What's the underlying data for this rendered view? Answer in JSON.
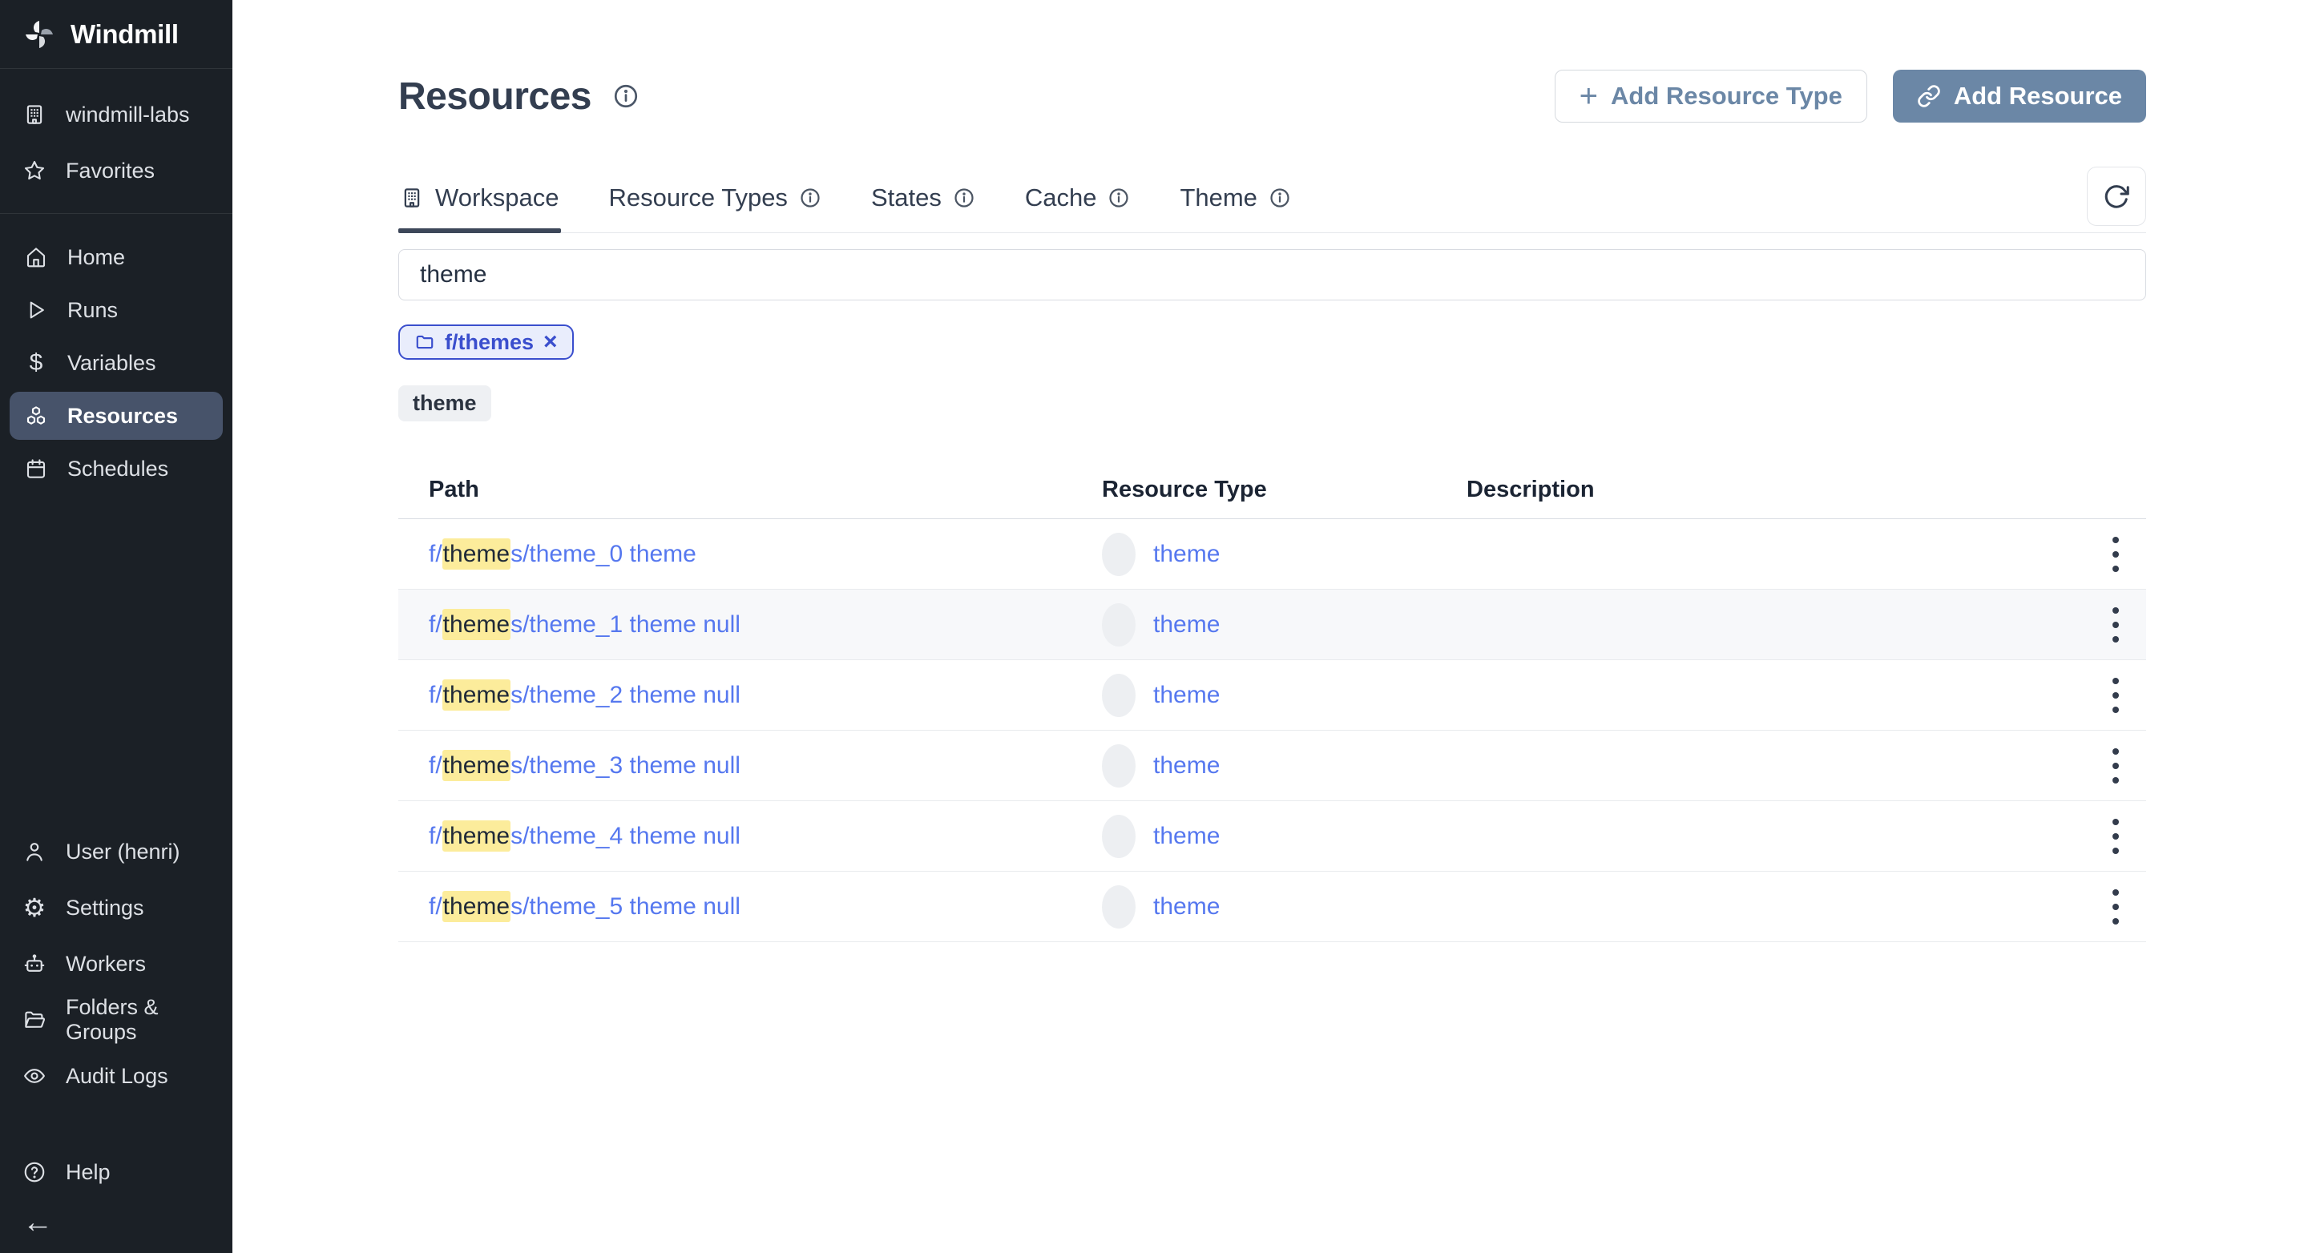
{
  "sidebar": {
    "brand": "Windmill",
    "top_items": [
      {
        "label": "windmill-labs",
        "icon": "building-icon"
      },
      {
        "label": "Favorites",
        "icon": "star-icon"
      }
    ],
    "nav": [
      {
        "label": "Home",
        "icon": "home-icon",
        "active": false
      },
      {
        "label": "Runs",
        "icon": "play-icon",
        "active": false
      },
      {
        "label": "Variables",
        "icon": "dollar-icon",
        "active": false
      },
      {
        "label": "Resources",
        "icon": "boxes-icon",
        "active": true
      },
      {
        "label": "Schedules",
        "icon": "calendar-icon",
        "active": false
      }
    ],
    "bottom": [
      {
        "label": "User (henri)",
        "icon": "user-icon"
      },
      {
        "label": "Settings",
        "icon": "gear-icon"
      },
      {
        "label": "Workers",
        "icon": "robot-icon"
      },
      {
        "label": "Folders & Groups",
        "icon": "folder-icon"
      },
      {
        "label": "Audit Logs",
        "icon": "eye-icon"
      }
    ],
    "help_label": "Help"
  },
  "header": {
    "title": "Resources",
    "add_resource_type_label": "Add Resource Type",
    "add_resource_label": "Add Resource"
  },
  "tabs": [
    {
      "label": "Workspace",
      "active": true,
      "icon": "building-icon"
    },
    {
      "label": "Resource Types",
      "active": false,
      "icon": "info-icon"
    },
    {
      "label": "States",
      "active": false,
      "icon": "info-icon"
    },
    {
      "label": "Cache",
      "active": false,
      "icon": "info-icon"
    },
    {
      "label": "Theme",
      "active": false,
      "icon": "info-icon"
    }
  ],
  "search": {
    "value": "theme"
  },
  "filter_chip": {
    "label": "f/themes",
    "close": "×"
  },
  "tag": "theme",
  "table": {
    "columns": [
      "Path",
      "Resource Type",
      "Description"
    ],
    "rows": [
      {
        "path_prefix": "f/",
        "path_highlight": "theme",
        "path_suffix": "s/theme_0 theme",
        "resource_type": "theme",
        "description": ""
      },
      {
        "path_prefix": "f/",
        "path_highlight": "theme",
        "path_suffix": "s/theme_1 theme null",
        "resource_type": "theme",
        "description": ""
      },
      {
        "path_prefix": "f/",
        "path_highlight": "theme",
        "path_suffix": "s/theme_2 theme null",
        "resource_type": "theme",
        "description": ""
      },
      {
        "path_prefix": "f/",
        "path_highlight": "theme",
        "path_suffix": "s/theme_3 theme null",
        "resource_type": "theme",
        "description": ""
      },
      {
        "path_prefix": "f/",
        "path_highlight": "theme",
        "path_suffix": "s/theme_4 theme null",
        "resource_type": "theme",
        "description": ""
      },
      {
        "path_prefix": "f/",
        "path_highlight": "theme",
        "path_suffix": "s/theme_5 theme null",
        "resource_type": "theme",
        "description": ""
      }
    ]
  },
  "colors": {
    "link_blue": "#5678ef",
    "highlight_yellow": "#fcec9b",
    "chip_indigo": "#3a4ecd",
    "button_slate_blue": "#6b87a6",
    "sidebar_bg": "#1b2026",
    "sidebar_active_bg": "#47536a"
  }
}
